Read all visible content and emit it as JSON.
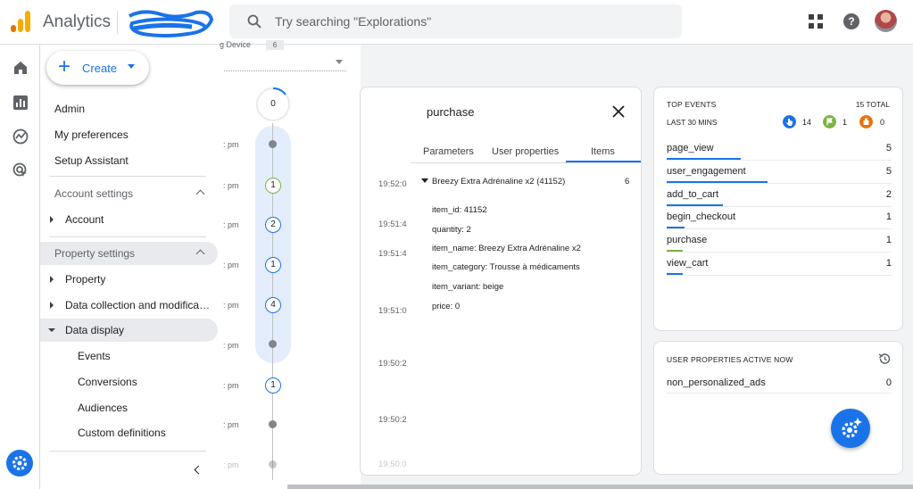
{
  "header": {
    "app_title": "Analytics",
    "search_placeholder": "Try searching \"Explorations\"",
    "help_glyph": "?",
    "brand_colors": {
      "bar1": "#f9ab00",
      "bar2": "#e37400",
      "accent": "#1a73e8"
    }
  },
  "rail": {
    "icons": [
      "home-icon",
      "reports-icon",
      "explore-icon",
      "advertising-icon",
      "settings-icon"
    ]
  },
  "nav": {
    "create_label": "Create",
    "items": {
      "admin": "Admin",
      "prefs": "My preferences",
      "setup": "Setup Assistant",
      "account_settings": "Account settings",
      "account": "Account",
      "property_settings": "Property settings",
      "property": "Property",
      "data_collection": "Data collection and modifica…",
      "data_display": "Data display",
      "events": "Events",
      "conversions": "Conversions",
      "audiences": "Audiences",
      "custom_definitions": "Custom definitions"
    }
  },
  "timeline": {
    "top_label": "g Device",
    "top_badge": "6",
    "top_count": "0",
    "times": [
      ": pm",
      ": pm",
      ": pm",
      ": pm",
      ": pm",
      ": pm",
      ": pm",
      ": pm",
      ": pm"
    ],
    "counts": {
      "r1": "1",
      "r2": "2",
      "r3": "1",
      "r4": "4",
      "r5": "1"
    }
  },
  "event_detail": {
    "title": "purchase",
    "tabs": [
      "Parameters",
      "User properties",
      "Items"
    ],
    "active_tab": "Items",
    "times": [
      "19:52:0",
      "19:51:4",
      "19:51:4",
      "19:51:0",
      "19:50:2",
      "19:50:2",
      "19:50:0"
    ],
    "item_header": "Breezy Extra Adrénaline x2 (41152)",
    "item_count": "6",
    "params": [
      "item_id: 41152",
      "quantity: 2",
      "item_name: Breezy Extra Adrénaline x2",
      "item_category: Trousse à médicaments",
      "item_variant: beige",
      "price: 0"
    ]
  },
  "top_events": {
    "title": "TOP EVENTS",
    "total": "15 TOTAL",
    "subtitle": "LAST 30 MINS",
    "badges": {
      "touch": "14",
      "flag": "1",
      "error": "0"
    },
    "rows": [
      {
        "name": "page_view",
        "value": "5",
        "fraction": 0.33,
        "color": "#1a73e8"
      },
      {
        "name": "user_engagement",
        "value": "5",
        "fraction": 0.45,
        "color": "#1a73e8"
      },
      {
        "name": "add_to_cart",
        "value": "2",
        "fraction": 0.25,
        "color": "#1a73e8"
      },
      {
        "name": "begin_checkout",
        "value": "1",
        "fraction": 0.08,
        "color": "#1a73e8"
      },
      {
        "name": "purchase",
        "value": "1",
        "fraction": 0.07,
        "color": "#7cb342"
      },
      {
        "name": "view_cart",
        "value": "1",
        "fraction": 0.07,
        "color": "#1a73e8"
      }
    ]
  },
  "user_properties": {
    "title": "USER PROPERTIES ACTIVE NOW",
    "rows": [
      {
        "name": "non_personalized_ads",
        "value": "0"
      }
    ]
  }
}
